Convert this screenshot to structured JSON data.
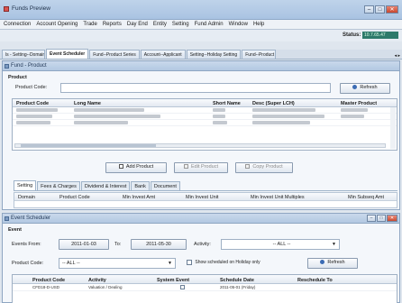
{
  "window": {
    "title": "Funds Preview",
    "controls": {
      "minimize": "–",
      "maximize": "□",
      "close": "✕"
    }
  },
  "menu": [
    "Connection",
    "Account Opening",
    "Trade",
    "Reports",
    "Day End",
    "Entity",
    "Setting",
    "Fund Admin",
    "Window",
    "Help"
  ],
  "status": {
    "label": "Status:",
    "value": "10.7.65.47"
  },
  "tabs": [
    "ls - Setting--Domain Setting",
    "Event Scheduler",
    "Fund--Product Series",
    "Account--Applicant",
    "Setting--Holiday Setting",
    "Fund--Product"
  ],
  "tabs_nav": "◂ ▸",
  "fund_product": {
    "title": "Fund - Product",
    "section": "Product",
    "product_code_label": "Product Code:",
    "product_code_value": "",
    "refresh": "Refresh",
    "columns": [
      "Product Code",
      "Long Name",
      "Short Name",
      "Desc (Super LCH)",
      "Master Product"
    ],
    "buttons": {
      "add": "Add Product",
      "edit": "Edit Product",
      "copy": "Copy Product"
    },
    "subtabs": [
      "Setting",
      "Fees & Charges",
      "Dividend & Interest",
      "Bank",
      "Document"
    ],
    "subgrid_columns": [
      "Domain",
      "Product Code",
      "Min Invest Amt",
      "Min Invest Unit",
      "Min Invest Unit Multiples",
      "Min Subseq Amt"
    ]
  },
  "event_scheduler": {
    "title": "Event Scheduler",
    "section": "Event",
    "events_from_label": "Events From:",
    "from_date": "2011-01-03",
    "to_label": "To:",
    "to_date": "2011-05-30",
    "activity_label": "Activity:",
    "activity_value": "-- ALL --",
    "product_code_label": "Product Code:",
    "product_code_value": "-- ALL --",
    "holiday_check_label": "Show scheduled on Holiday only",
    "refresh": "Refresh",
    "columns": [
      "Product Code",
      "Activity",
      "System Event",
      "Schedule Date",
      "Reschedule To"
    ],
    "rows": [
      {
        "product_code": "CFD18-D-USD",
        "activity": "Valuation / Dealing",
        "system_event": "",
        "schedule_date": "2011-05-01 (Friday)",
        "reschedule_to": ""
      }
    ]
  }
}
